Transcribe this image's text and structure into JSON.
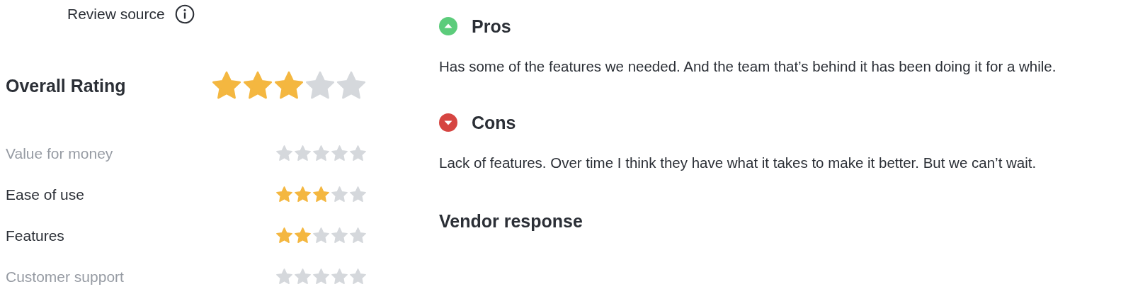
{
  "review_source": {
    "label": "Review source"
  },
  "overall": {
    "label": "Overall Rating",
    "stars": 3
  },
  "ratings": [
    {
      "label": "Value for money",
      "stars": 0
    },
    {
      "label": "Ease of use",
      "stars": 3
    },
    {
      "label": "Features",
      "stars": 2
    },
    {
      "label": "Customer support",
      "stars": 0
    }
  ],
  "sections": [
    {
      "kind": "pros",
      "title": "Pros",
      "text": "Has some of the features we needed. And the team that’s behind it has been doing it for a while."
    },
    {
      "kind": "cons",
      "title": "Cons",
      "text": "Lack of features. Over time I think they have what it takes to make it better. But we can’t wait."
    }
  ],
  "vendor_response": {
    "title": "Vendor response"
  }
}
